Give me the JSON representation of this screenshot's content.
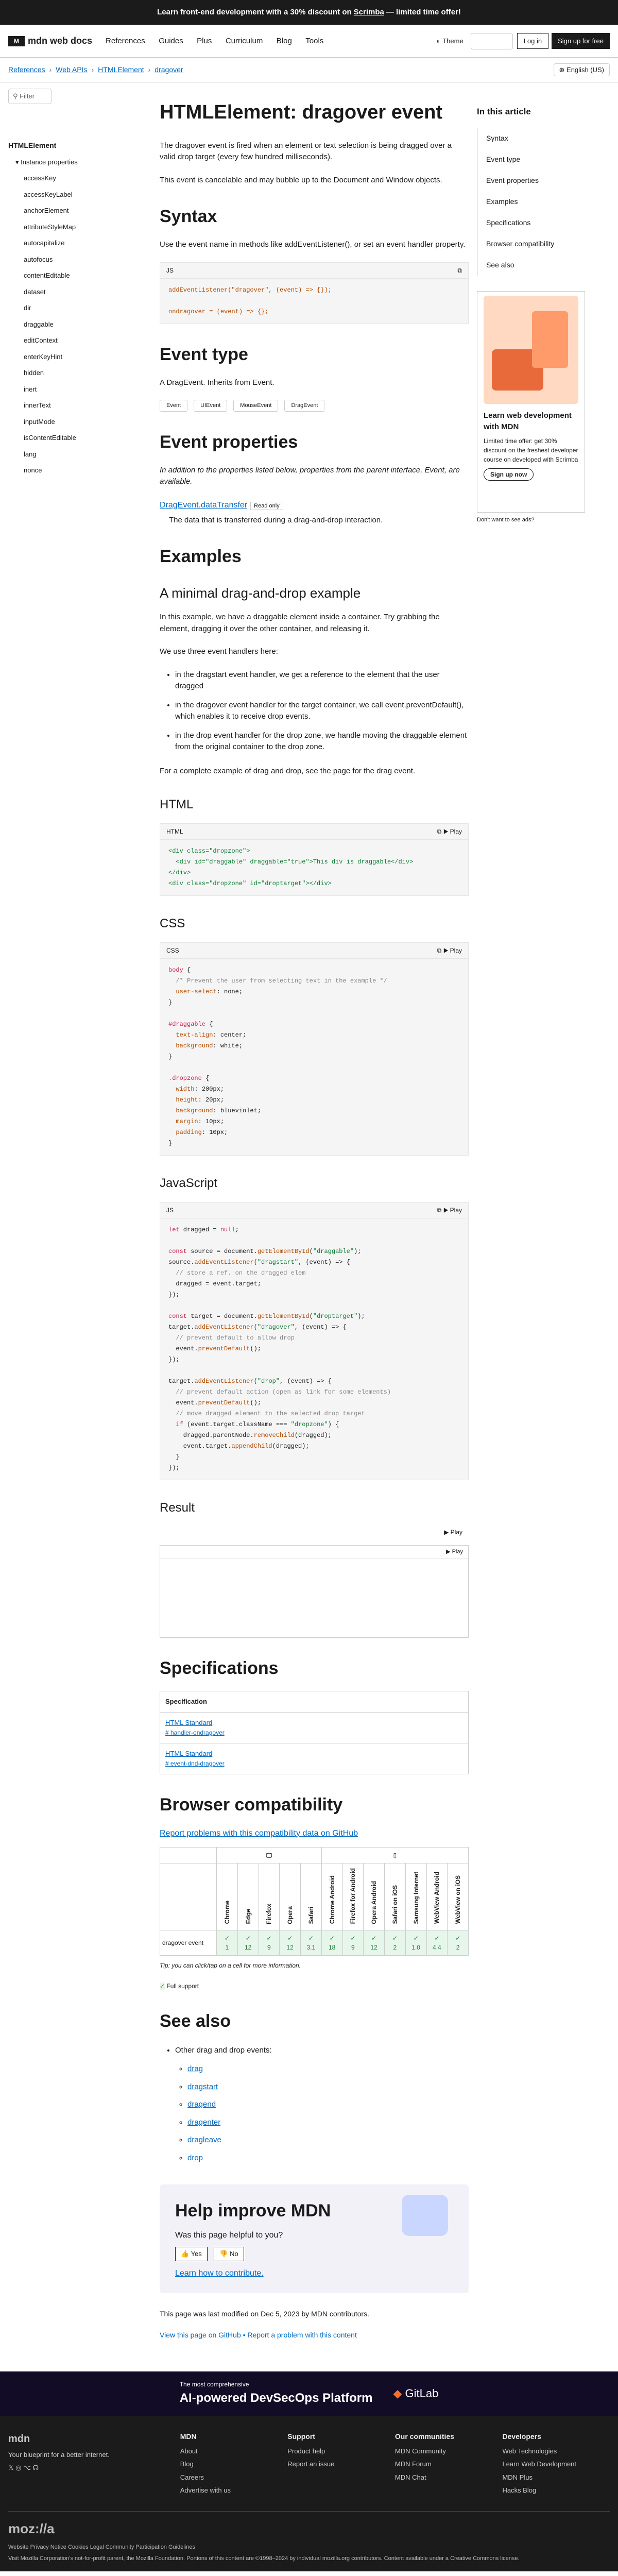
{
  "banner": {
    "text": "Learn front-end development with a 30% discount on",
    "link": "Scrimba",
    "tail": "— limited time offer!"
  },
  "nav": {
    "logo": "mdn web docs",
    "items": [
      "References",
      "Guides",
      "Plus",
      "Curriculum",
      "Blog",
      "Tools"
    ],
    "theme": "Theme",
    "login": "Log in",
    "signup": "Sign up for free"
  },
  "crumbs": [
    "References",
    "Web APIs",
    "HTMLElement",
    "dragover"
  ],
  "lang": "English (US)",
  "sidebar": {
    "filter": "Filter",
    "title": "HTMLElement",
    "section": "Instance properties",
    "items": [
      "accessKey",
      "accessKeyLabel",
      "anchorElement",
      "attributeStyleMap",
      "autocapitalize",
      "autofocus",
      "contentEditable",
      "dataset",
      "dir",
      "draggable",
      "editContext",
      "enterKeyHint",
      "hidden",
      "inert",
      "innerText",
      "inputMode",
      "isContentEditable",
      "lang",
      "nonce"
    ]
  },
  "toc": {
    "title": "In this article",
    "items": [
      "Syntax",
      "Event type",
      "Event properties",
      "Examples",
      "Specifications",
      "Browser compatibility",
      "See also"
    ]
  },
  "ad": {
    "title": "Learn web development with MDN",
    "body": "Limited time offer: get 30% discount on the freshest developer course on developed with Scrimba",
    "cta": "Sign up now",
    "foot": "Don't want to see ads?"
  },
  "article": {
    "title": "HTMLElement: dragover event",
    "intro1": "The dragover event is fired when an element or text selection is being dragged over a valid drop target (every few hundred milliseconds).",
    "intro2": "This event is cancelable and may bubble up to the Document and Window objects.",
    "syntax_h": "Syntax",
    "syntax_p": "Use the event name in methods like addEventListener(), or set an event handler property.",
    "js": "JS",
    "code1a": "addEventListener(\"dragover\", (event) => {});",
    "code1b": "ondragover = (event) => {};",
    "evtype_h": "Event type",
    "evtype_p": "A DragEvent. Inherits from Event.",
    "tags": [
      "Event",
      "UIEvent",
      "MouseEvent",
      "DragEvent"
    ],
    "evprops_h": "Event properties",
    "evprops_p": "In addition to the properties listed below, properties from the parent interface, Event, are available.",
    "prop_name": "DragEvent.dataTransfer",
    "prop_badge": "Read only",
    "prop_desc": "The data that is transferred during a drag-and-drop interaction.",
    "examples_h": "Examples",
    "ex_h3": "A minimal drag-and-drop example",
    "ex_p1": "In this example, we have a draggable element inside a container. Try grabbing the element, dragging it over the other container, and releasing it.",
    "ex_p2": "We use three event handlers here:",
    "bullets": [
      "in the dragstart event handler, we get a reference to the element that the user dragged",
      "in the dragover event handler for the target container, we call event.preventDefault(), which enables it to receive drop events.",
      "in the drop event handler for the drop zone, we handle moving the draggable element from the original container to the drop zone."
    ],
    "ex_p3": "For a complete example of drag and drop, see the page for the drag event.",
    "html_h": "HTML",
    "css_h": "CSS",
    "js_h": "JavaScript",
    "result_h": "Result",
    "play": "Play",
    "html_label": "HTML",
    "css_label": "CSS",
    "spec_h": "Specifications",
    "spec_th": "Specification",
    "spec_rows": [
      {
        "name": "HTML Standard",
        "sub": "# handler-ondragover"
      },
      {
        "name": "HTML Standard",
        "sub": "# event-dnd-dragover"
      }
    ],
    "compat_h": "Browser compatibility",
    "compat_link": "Report problems with this compatibility data on GitHub",
    "browsers": [
      "Chrome",
      "Edge",
      "Firefox",
      "Opera",
      "Safari",
      "Chrome Android",
      "Firefox for Android",
      "Opera Android",
      "Safari on iOS",
      "Samsung Internet",
      "WebView Android",
      "WebView on iOS"
    ],
    "compat_row": "dragover event",
    "versions": [
      "1",
      "12",
      "9",
      "12",
      "3.1",
      "18",
      "9",
      "12",
      "2",
      "1.0",
      "4.4",
      "2"
    ],
    "compat_tip": "Tip: you can click/tap on a cell for more information.",
    "full": "Full support",
    "see_h": "See also",
    "see_top": "Other drag and drop events:",
    "see_items": [
      "drag",
      "dragstart",
      "dragend",
      "dragenter",
      "dragleave",
      "drop"
    ],
    "fb_h": "Help improve MDN",
    "fb_q": "Was this page helpful to you?",
    "yes": "Yes",
    "no": "No",
    "fb_link": "Learn how to contribute.",
    "modified": "This page was last modified on Dec 5, 2023 by MDN contributors.",
    "github": "View this page on GitHub • Report a problem with this content"
  },
  "gitlab": {
    "small": "The most comprehensive",
    "big": "AI-powered DevSecOps Platform",
    "brand": "GitLab"
  },
  "footer": {
    "logo": "mdn",
    "tag": "Your blueprint for a better internet.",
    "cols": [
      {
        "h": "MDN",
        "items": [
          "About",
          "Blog",
          "Careers",
          "Advertise with us"
        ]
      },
      {
        "h": "Support",
        "items": [
          "Product help",
          "Report an issue"
        ]
      },
      {
        "h": "Our communities",
        "items": [
          "MDN Community",
          "MDN Forum",
          "MDN Chat"
        ]
      },
      {
        "h": "Developers",
        "items": [
          "Web Technologies",
          "Learn Web Development",
          "MDN Plus",
          "Hacks Blog"
        ]
      }
    ],
    "moz": "moz://a",
    "legal": "Website Privacy Notice   Cookies   Legal   Community Participation Guidelines",
    "copy": "Visit Mozilla Corporation's not-for-profit parent, the Mozilla Foundation. Portions of this content are ©1998–2024 by individual mozilla.org contributors. Content available under a Creative Commons license."
  }
}
